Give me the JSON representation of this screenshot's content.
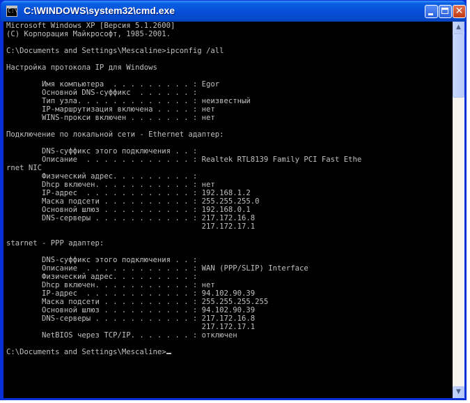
{
  "window": {
    "title": "C:\\WINDOWS\\system32\\cmd.exe",
    "icon_label": "C:\\"
  },
  "console": {
    "lines": [
      "Microsoft Windows XP [Версия 5.1.2600]",
      "(С) Корпорация Майкрософт, 1985-2001.",
      "",
      "C:\\Documents and Settings\\Mescaline>ipconfig /all",
      "",
      "Настройка протокола IP для Windows",
      "",
      "        Имя компьютера  . . . . . . . . . : Egor",
      "        Основной DNS-суффикс  . . . . . . :",
      "        Тип узла. . . . . . . . . . . . . : неизвестный",
      "        IP-маршрутизация включена . . . . : нет",
      "        WINS-прокси включен . . . . . . . : нет",
      "",
      "Подключение по локальной сети - Ethernet адаптер:",
      "",
      "        DNS-суффикс этого подключения . . :",
      "        Описание  . . . . . . . . . . . . : Realtek RTL8139 Family PCI Fast Ethe",
      "rnet NIC",
      "        Физический адрес. . . . . . . . . :",
      "        Dhcp включен. . . . . . . . . . . : нет",
      "        IP-адрес  . . . . . . . . . . . . : 192.168.1.2",
      "        Маска подсети . . . . . . . . . . : 255.255.255.0",
      "        Основной шлюз . . . . . . . . . . : 192.168.0.1",
      "        DNS-серверы . . . . . . . . . . . : 217.172.16.8",
      "                                            217.172.17.1",
      "",
      "starnet - PPP адаптер:",
      "",
      "        DNS-суффикс этого подключения . . :",
      "        Описание  . . . . . . . . . . . . : WAN (PPP/SLIP) Interface",
      "        Физический адрес. . . . . . . . . :",
      "        Dhcp включен. . . . . . . . . . . : нет",
      "        IP-адрес  . . . . . . . . . . . . : 94.102.90.39",
      "        Маска подсети . . . . . . . . . . : 255.255.255.255",
      "        Основной шлюз . . . . . . . . . . : 94.102.90.39",
      "        DNS-серверы . . . . . . . . . . . : 217.172.16.8",
      "                                            217.172.17.1",
      "        NetBIOS через TCP/IP. . . . . . . : отключен",
      "",
      "C:\\Documents and Settings\\Mescaline>"
    ]
  },
  "scrollbar": {
    "up_arrow": "▲",
    "down_arrow": "▼"
  },
  "controls": {
    "close_glyph": "✕"
  }
}
